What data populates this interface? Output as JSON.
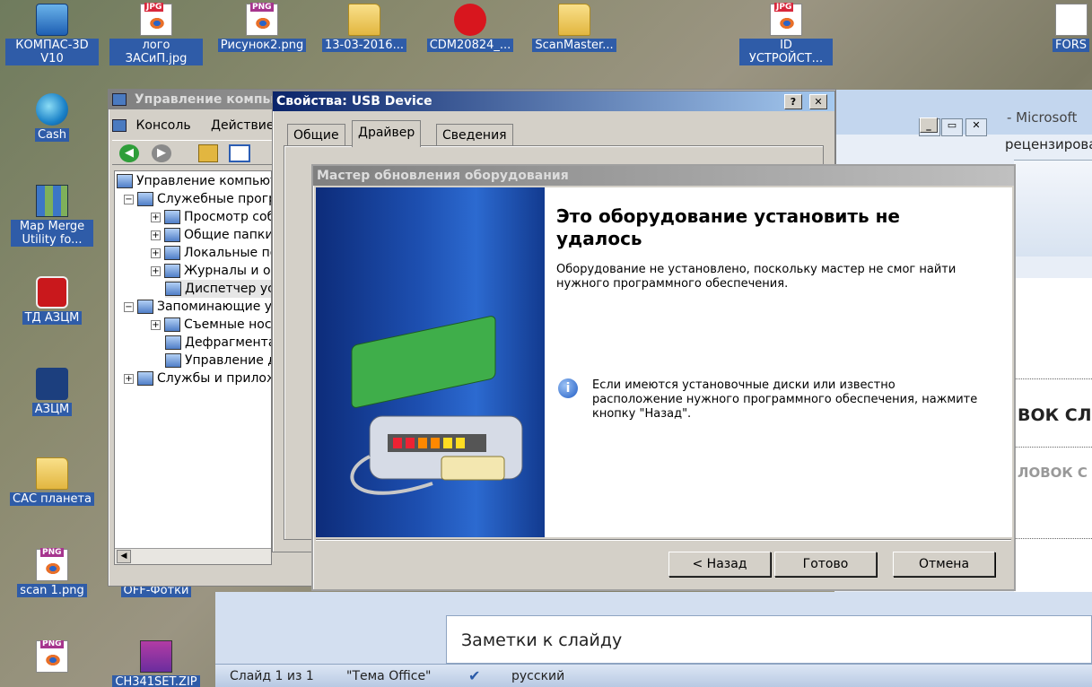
{
  "desktop_icons": [
    {
      "label": "КОМПАС-3D V10",
      "icon": "kompas-icon"
    },
    {
      "label": "лого ЗАСиП.jpg",
      "icon": "jpg-file-icon"
    },
    {
      "label": "Рисунок2.png",
      "icon": "png-file-icon"
    },
    {
      "label": "13-03-2016...",
      "icon": "folder-icon"
    },
    {
      "label": "CDM20824_...",
      "icon": "cdm-icon"
    },
    {
      "label": "ScanMaster...",
      "icon": "folder-icon"
    },
    {
      "label": "ID УСТРОЙСТ...",
      "icon": "jpg-file-icon"
    },
    {
      "label": "FORS",
      "icon": "file-icon"
    },
    {
      "label": "Cash",
      "icon": "cash-icon"
    },
    {
      "label": "Map Merge Utility fo...",
      "icon": "map-icon"
    },
    {
      "label": "ТД АЗЦМ",
      "icon": "td-icon"
    },
    {
      "label": "АЗЦМ",
      "icon": "lock-icon"
    },
    {
      "label": "САС планета",
      "icon": "folder-icon"
    },
    {
      "label": "scan 1.png",
      "icon": "png-file-icon"
    },
    {
      "label": "OFF-Фотки",
      "icon": "folder-icon"
    },
    {
      "label": "CH341SET.ZIP",
      "icon": "rar-icon"
    }
  ],
  "mmc": {
    "title": "Управление компьютером",
    "menu": [
      "Консоль",
      "Действие"
    ],
    "tree": [
      {
        "label": "Управление компьютером",
        "pm": ""
      },
      {
        "label": "Служебные программы",
        "pm": "−"
      },
      {
        "label": "Просмотр событий",
        "pm": "+"
      },
      {
        "label": "Общие папки",
        "pm": "+"
      },
      {
        "label": "Локальные пользователи",
        "pm": "+"
      },
      {
        "label": "Журналы и оповещения",
        "pm": "+"
      },
      {
        "label": "Диспетчер устройств",
        "pm": ""
      },
      {
        "label": "Запоминающие устройства",
        "pm": "−"
      },
      {
        "label": "Съемные носители",
        "pm": "+"
      },
      {
        "label": "Дефрагментация диска",
        "pm": ""
      },
      {
        "label": "Управление дисками",
        "pm": ""
      },
      {
        "label": "Службы и приложения",
        "pm": "+"
      }
    ]
  },
  "props": {
    "title": "Свойства: USB Device",
    "help": "?",
    "close": "✕",
    "tabs": [
      "Общие",
      "Драйвер",
      "Сведения"
    ]
  },
  "wizard": {
    "title": "Мастер обновления оборудования",
    "heading": "Это оборудование установить не удалось",
    "message": "Оборудование не установлено, поскольку мастер не смог найти нужного программного обеспечения.",
    "info": "Если имеются установочные диски или известно расположение нужного программного обеспечения, нажмите кнопку \"Назад\".",
    "back": "< Назад",
    "finish": "Готово",
    "cancel": "Отмена"
  },
  "ppt": {
    "title": "- Microsoft",
    "ribbon_tab": "рецензирован",
    "slide_text_1": "ВОК СЛ",
    "slide_text_2": "ЛОВОК С",
    "notes": "Заметки к слайду",
    "status_slide": "Слайд 1 из 1",
    "status_theme": "\"Тема Office\"",
    "status_lang": "русский"
  }
}
